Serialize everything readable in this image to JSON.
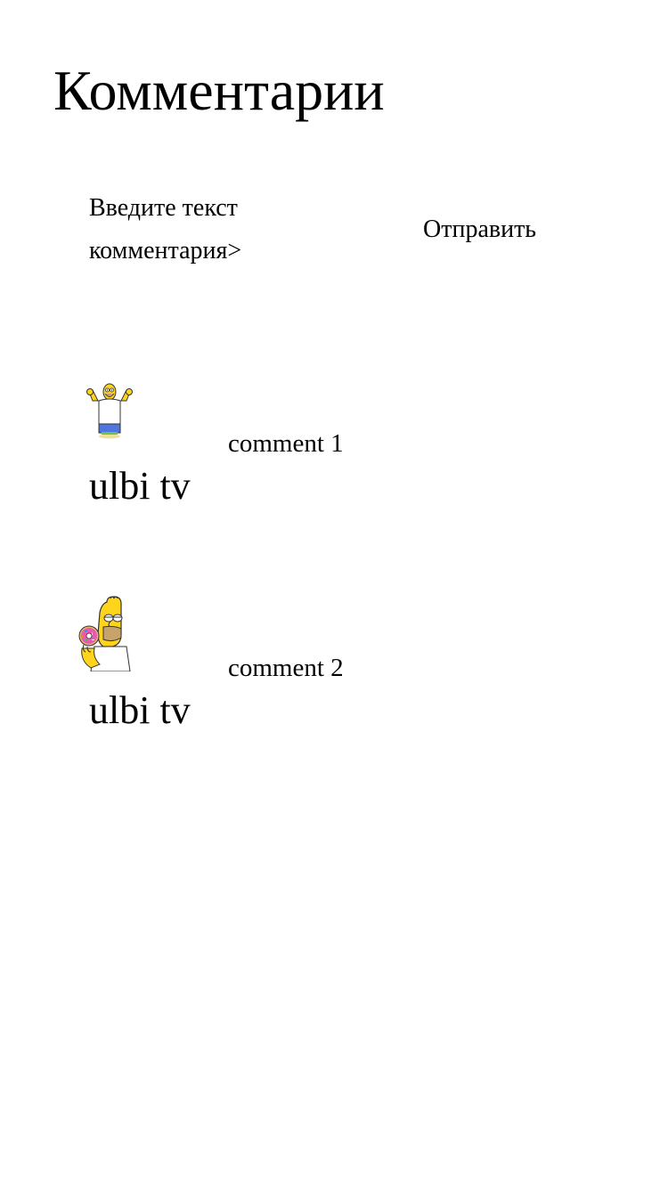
{
  "page": {
    "title": "Комментарии"
  },
  "composer": {
    "input_placeholder": "Введите текст комментария>",
    "input_value": "",
    "send_label": "Отправить"
  },
  "comments": [
    {
      "author": "ulbi tv",
      "text": "comment 1",
      "avatar_icon": "homer-arms-raised-avatar"
    },
    {
      "author": "ulbi tv",
      "text": "comment 2",
      "avatar_icon": "homer-donut-avatar"
    }
  ],
  "colors": {
    "homer_skin": "#FED41D",
    "donut_icing": "#E75BAE",
    "text": "#000000",
    "background": "#FFFFFF"
  }
}
